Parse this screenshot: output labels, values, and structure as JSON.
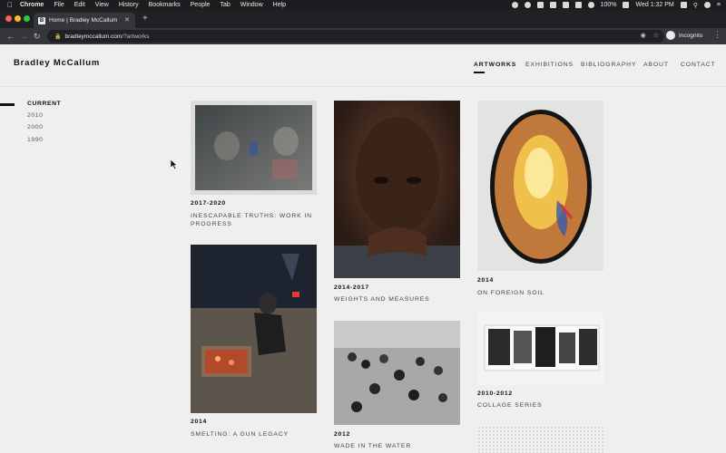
{
  "menubar": {
    "apple": "",
    "app": "Chrome",
    "items": [
      "File",
      "Edit",
      "View",
      "History",
      "Bookmarks",
      "People",
      "Tab",
      "Window",
      "Help"
    ],
    "battery": "100%",
    "clock": "Wed 1:32 PM"
  },
  "browser": {
    "tab_title": "Home | Bradley McCallum",
    "tab_favicon": "B",
    "url_domain": "bradleymccallum.com",
    "url_path": "/?artworks",
    "profile_label": "Incognito"
  },
  "site": {
    "title": "Bradley McCallum",
    "nav": [
      "ARTWORKS",
      "EXHIBITIONS",
      "BIBLIOGRAPHY",
      "ABOUT",
      "CONTACT"
    ]
  },
  "filters": [
    "CURRENT",
    "2010",
    "2000",
    "1990"
  ],
  "artworks": [
    {
      "year": "2017-2020",
      "title": "INESCAPABLE TRUTHS: WORK IN PROGRESS"
    },
    {
      "year": "2014",
      "title": "SMELTING: A GUN LEGACY"
    },
    {
      "year": "2014-2017",
      "title": "WEIGHTS AND MEASURES"
    },
    {
      "year": "2012",
      "title": "WADE IN THE WATER"
    },
    {
      "year": "2014",
      "title": "ON FOREIGN SOIL"
    },
    {
      "year": "2010-2012",
      "title": "COLLAGE SERIES"
    }
  ],
  "colors": {
    "page_bg": "#efefef",
    "text": "#111111",
    "muted": "#444444"
  }
}
